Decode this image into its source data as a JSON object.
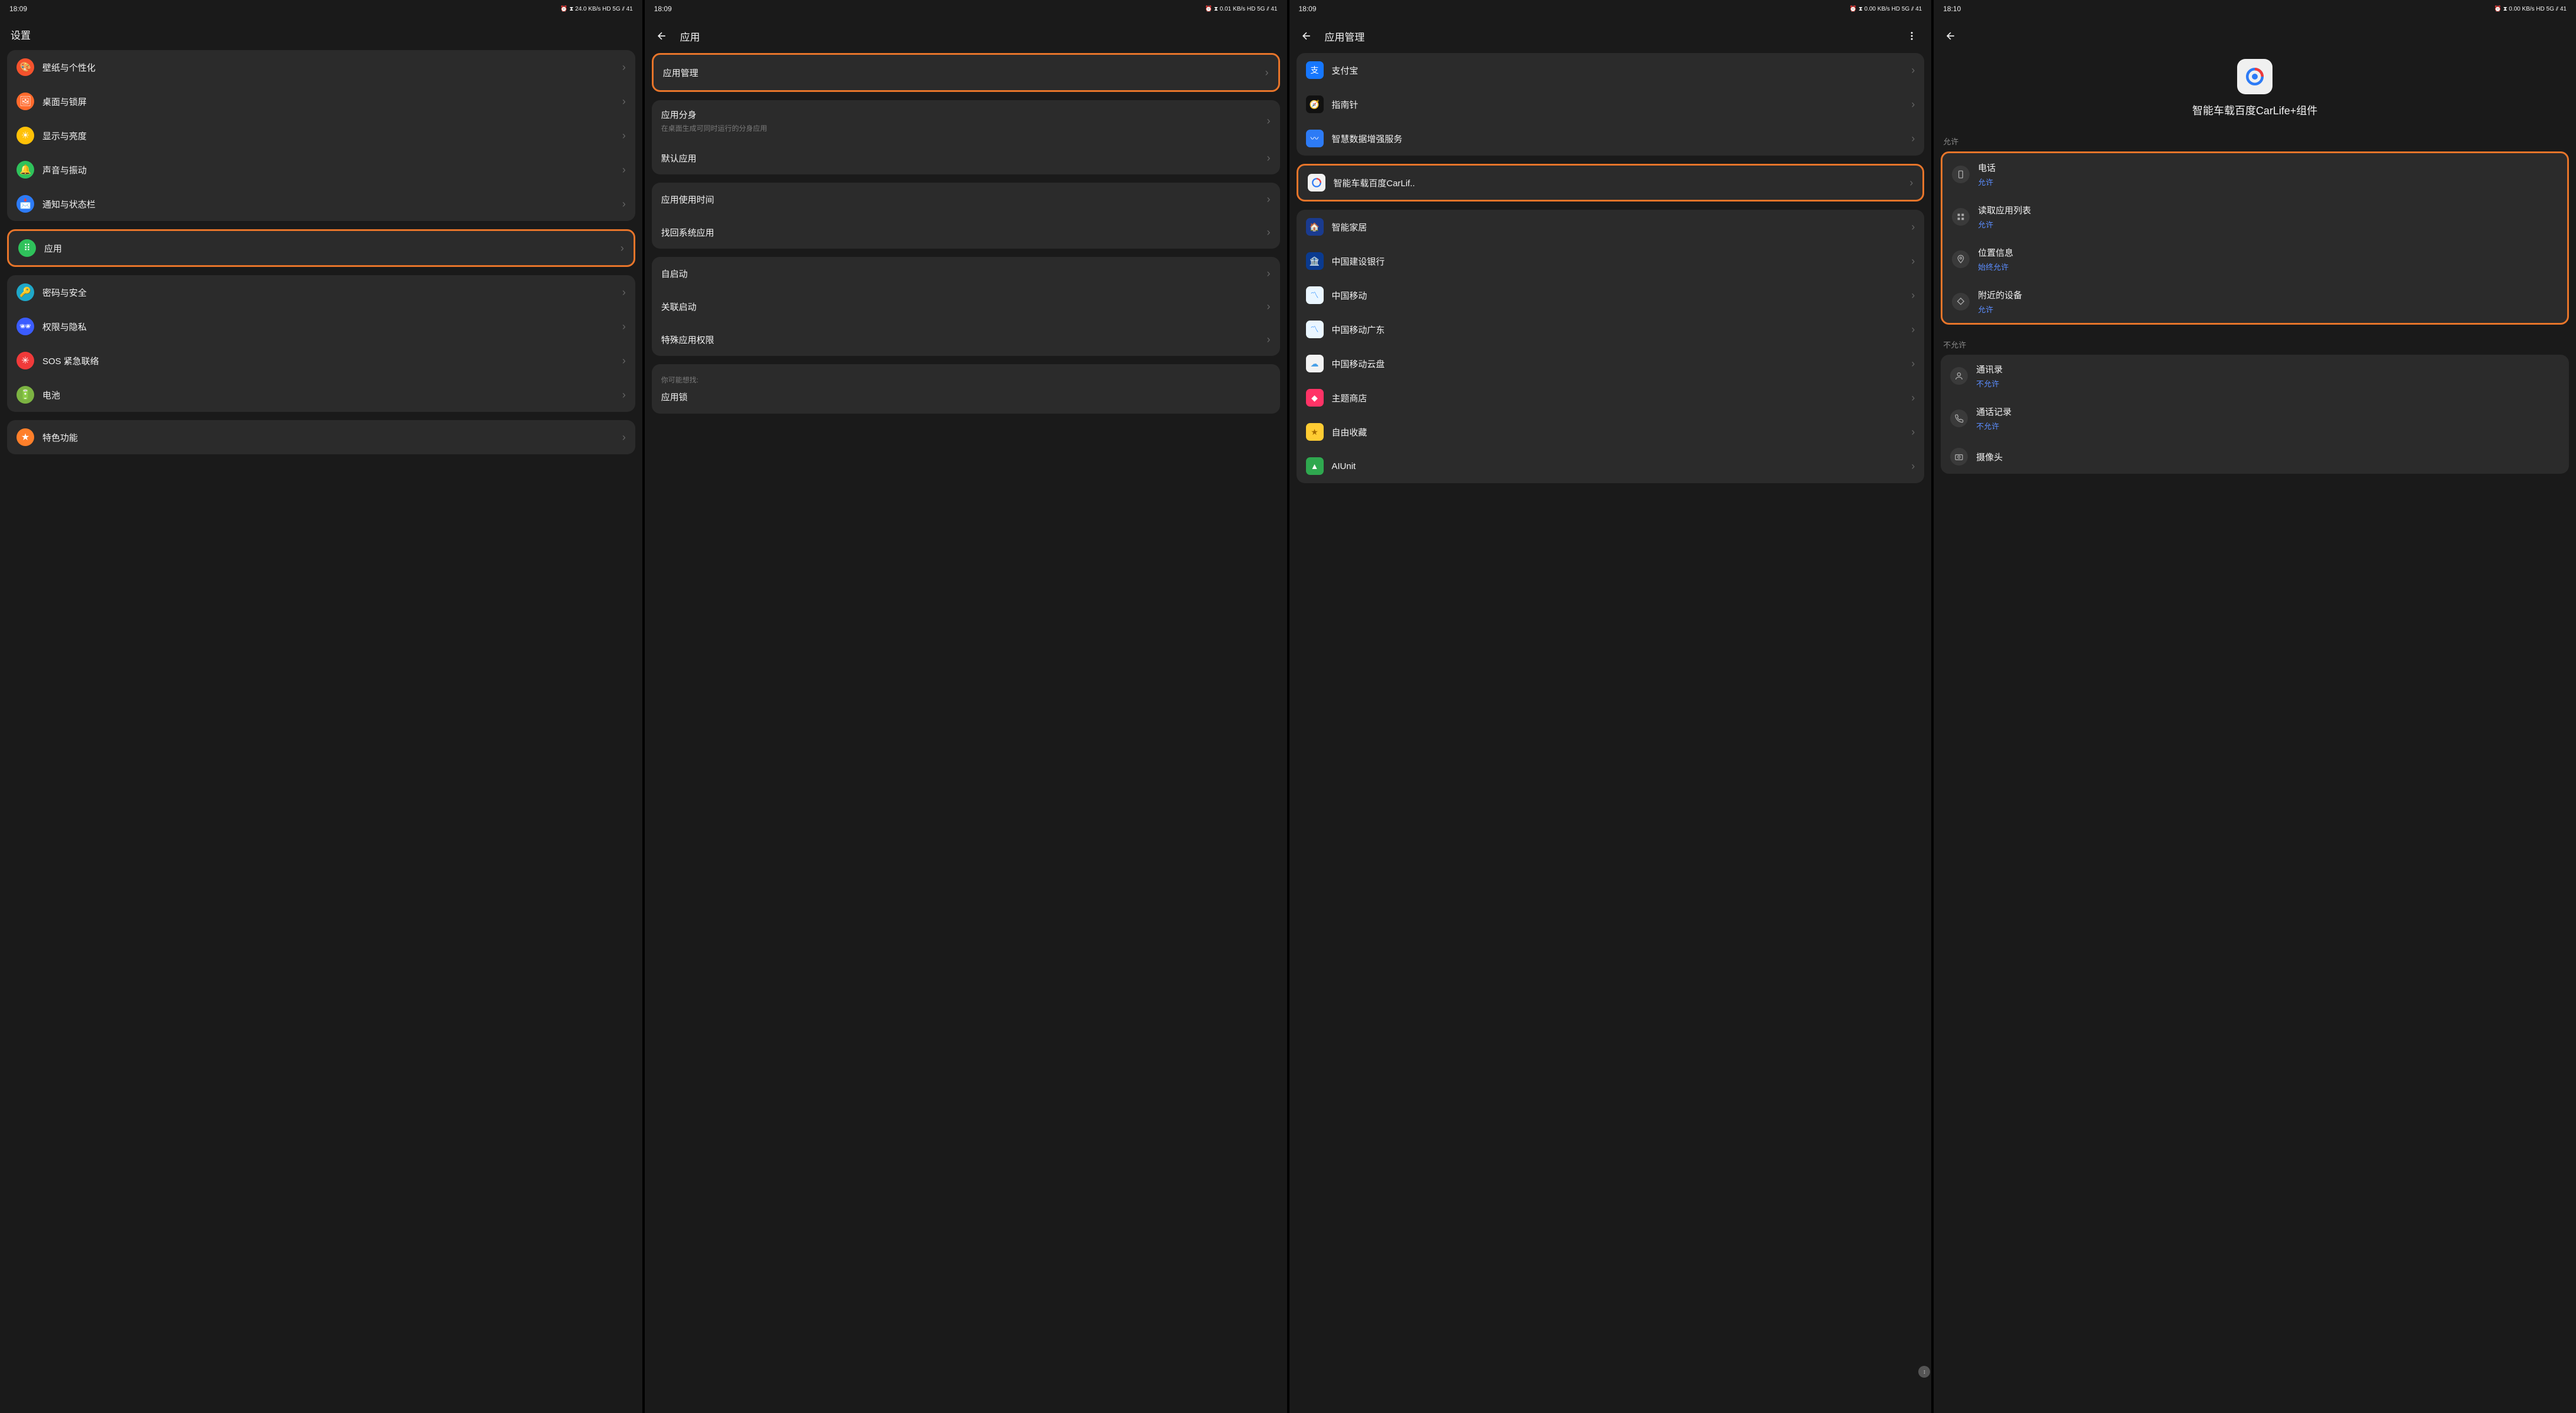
{
  "panels": {
    "p1": {
      "time": "18:09",
      "status_icons": "⏰ ⧗ 24.0 KB/s HD 5G ⫽ 41",
      "title": "设置",
      "groups": {
        "g1": [
          {
            "name": "wallpaper",
            "label": "壁纸与个性化",
            "icon_text": "🎨",
            "color": "ic-orange"
          },
          {
            "name": "desktop",
            "label": "桌面与锁屏",
            "icon_text": "🖼",
            "color": "ic-deeporange"
          },
          {
            "name": "display",
            "label": "显示与亮度",
            "icon_text": "☀",
            "color": "ic-yellow"
          },
          {
            "name": "sound",
            "label": "声音与振动",
            "icon_text": "🔔",
            "color": "ic-green"
          },
          {
            "name": "notify",
            "label": "通知与状态栏",
            "icon_text": "📩",
            "color": "ic-blue"
          }
        ],
        "highlighted": {
          "name": "apps",
          "label": "应用",
          "icon_text": "⠿",
          "color": "ic-greenapps"
        },
        "g2": [
          {
            "name": "security",
            "label": "密码与安全",
            "icon_text": "🔑",
            "color": "ic-teal"
          },
          {
            "name": "privacy",
            "label": "权限与隐私",
            "icon_text": "🕶",
            "color": "ic-darkblue"
          },
          {
            "name": "sos",
            "label": "SOS 紧急联络",
            "icon_text": "✳",
            "color": "ic-red"
          },
          {
            "name": "battery",
            "label": "电池",
            "icon_text": "🔋",
            "color": "ic-lime"
          }
        ],
        "g3": [
          {
            "name": "features",
            "label": "特色功能",
            "icon_text": "★",
            "color": "ic-star"
          }
        ]
      }
    },
    "p2": {
      "time": "18:09",
      "status_icons": "⏰ ⧗ 0.01 KB/s HD 5G ⫽ 41",
      "title": "应用",
      "highlighted": {
        "name": "app-management",
        "label": "应用管理"
      },
      "g1": [
        {
          "name": "app-clone",
          "label": "应用分身",
          "sublabel": "在桌面生成可同时运行的分身应用"
        },
        {
          "name": "default-apps",
          "label": "默认应用"
        }
      ],
      "g2": [
        {
          "name": "usage-time",
          "label": "应用使用时间"
        },
        {
          "name": "restore-sys",
          "label": "找回系统应用"
        }
      ],
      "g3": [
        {
          "name": "autostart",
          "label": "自启动"
        },
        {
          "name": "assoc-start",
          "label": "关联启动"
        },
        {
          "name": "special-perm",
          "label": "特殊应用权限"
        }
      ],
      "hint_title": "你可能想找:",
      "hint_item": "应用锁"
    },
    "p3": {
      "time": "18:09",
      "status_icons": "⏰ ⧗ 0.00 KB/s HD 5G ⫽ 41",
      "title": "应用管理",
      "apps": [
        {
          "name": "alipay",
          "label": "支付宝",
          "cls": "sq-alipay",
          "txt": "支"
        },
        {
          "name": "compass",
          "label": "指南针",
          "cls": "sq-compass",
          "txt": "🧭"
        },
        {
          "name": "smartdata",
          "label": "智慧数据增强服务",
          "cls": "sq-smartdata",
          "txt": "〰"
        }
      ],
      "highlighted": {
        "name": "carlife",
        "label": "智能车载百度CarLif..",
        "cls": "sq-carlife",
        "txt": "◎"
      },
      "apps2": [
        {
          "name": "smarthome",
          "label": "智能家居",
          "cls": "sq-smarthome",
          "txt": "🏠"
        },
        {
          "name": "ccb",
          "label": "中国建设银行",
          "cls": "sq-ccb",
          "txt": "🏦"
        },
        {
          "name": "cm",
          "label": "中国移动",
          "cls": "sq-cm",
          "txt": "〽"
        },
        {
          "name": "cmgd",
          "label": "中国移动广东",
          "cls": "sq-cmgd",
          "txt": "〽"
        },
        {
          "name": "cloud",
          "label": "中国移动云盘",
          "cls": "sq-cloud",
          "txt": "☁"
        },
        {
          "name": "theme",
          "label": "主题商店",
          "cls": "sq-theme",
          "txt": "◆"
        },
        {
          "name": "fav",
          "label": "自由收藏",
          "cls": "sq-fav",
          "txt": "★"
        },
        {
          "name": "aiunit",
          "label": "AIUnit",
          "cls": "sq-aiunit",
          "txt": "▲"
        }
      ]
    },
    "p4": {
      "time": "18:10",
      "status_icons": "⏰ ⧗ 0.00 KB/s HD 5G ⫽ 41",
      "app_title": "智能车载百度CarLife+组件",
      "section_allow": "允许",
      "section_deny": "不允许",
      "allow_status": "允许",
      "always_allow": "始终允许",
      "deny_status": "不允许",
      "perms_allow": [
        {
          "name": "phone",
          "label": "电话",
          "icon": "phone-icon",
          "status_key": "allow_status"
        },
        {
          "name": "applist",
          "label": "读取应用列表",
          "icon": "grid-icon",
          "status_key": "allow_status"
        },
        {
          "name": "location",
          "label": "位置信息",
          "icon": "pin-icon",
          "status_key": "always_allow"
        },
        {
          "name": "nearby",
          "label": "附近的设备",
          "icon": "devices-icon",
          "status_key": "allow_status"
        }
      ],
      "perms_deny": [
        {
          "name": "contacts",
          "label": "通讯录",
          "icon": "contacts-icon"
        },
        {
          "name": "calllog",
          "label": "通话记录",
          "icon": "call-icon"
        },
        {
          "name": "camera",
          "label": "摄像头",
          "icon": "camera-icon"
        }
      ]
    }
  }
}
